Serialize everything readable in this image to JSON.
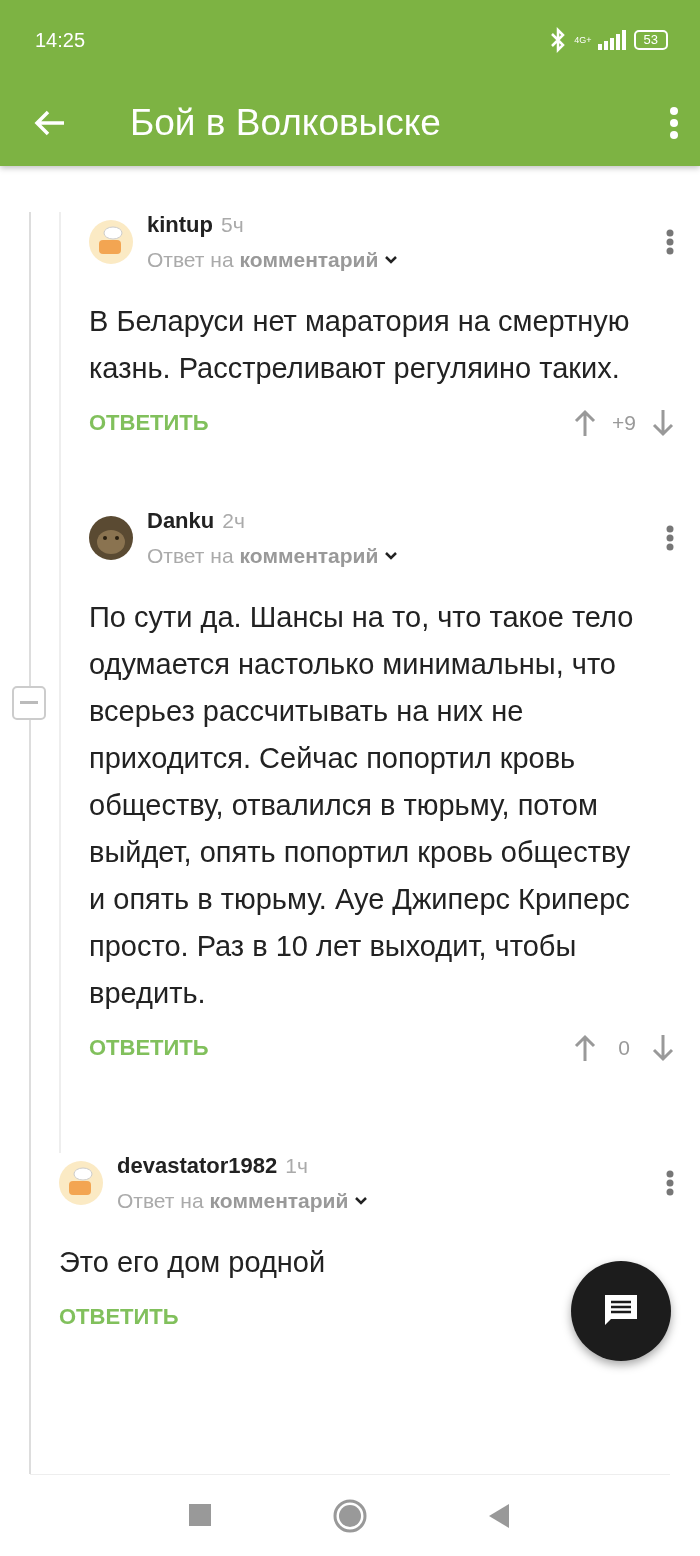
{
  "status_bar": {
    "time": "14:25",
    "network": "4G+",
    "battery": "53"
  },
  "toolbar": {
    "title": "Бой в Волковыске"
  },
  "nested_replies": [
    {
      "author": "kintup",
      "time": "5ч",
      "kind": "default",
      "reply_prefix": "Ответ на",
      "reply_link": "комментарий",
      "text": "В Беларуси нет маратория на смертную казнь. Расстреливают регуляино таких.",
      "reply_label": "ОТВЕТИТЬ",
      "score": "+9"
    },
    {
      "author": "Danku",
      "time": "2ч",
      "kind": "photo",
      "reply_prefix": "Ответ на",
      "reply_link": "комментарий",
      "text": "По сути да. Шансы на то, что такое тело одумается настолько минимальны, что всерьез рассчитывать на них не приходится. Сейчас попортил кровь обществу, отвалился в тюрьму, потом выйдет, опять попортил кровь обществу и опять в тюрьму. Ауе Джиперс Криперс просто. Раз в 10 лет выходит, чтобы вредить.",
      "reply_label": "ОТВЕТИТЬ",
      "score": "0"
    }
  ],
  "comments": [
    {
      "author": "devastator1982",
      "time": "1ч",
      "kind": "default",
      "reply_prefix": "Ответ на",
      "reply_link": "комментарий",
      "text": "Это его дом родной",
      "reply_label": "ОТВЕТИТЬ"
    }
  ]
}
